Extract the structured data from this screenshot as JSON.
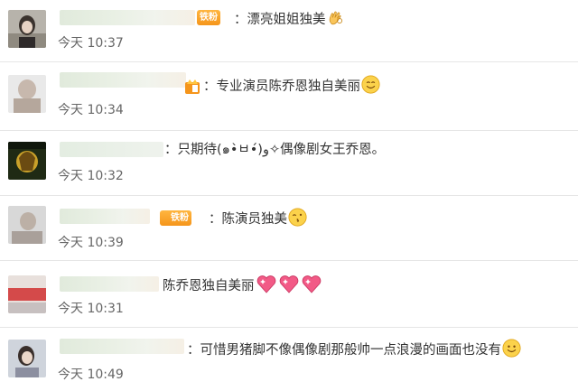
{
  "comments": [
    {
      "prefix": "：",
      "text": "漂亮姐姐独美",
      "emoji": "ok-hand-emoji",
      "badge": "铁粉",
      "time": "今天 10:37"
    },
    {
      "prefix": "：",
      "text": "专业演员陈乔恩独自美丽",
      "emoji": "smile-emoji",
      "badge": "",
      "time": "今天 10:34"
    },
    {
      "prefix": "：",
      "text": "只期待(๑•̀ㅂ•́)و✧偶像剧女王乔恩。",
      "emoji": "",
      "badge": "",
      "time": "今天 10:32"
    },
    {
      "prefix": "：",
      "text": "陈演员独美",
      "emoji": "kiss-emoji",
      "badge": "铁粉",
      "time": "今天 10:39"
    },
    {
      "prefix": "",
      "text": "陈乔恩独自美丽",
      "emoji": "hearts-emoji",
      "badge": "",
      "time": "今天 10:31"
    },
    {
      "prefix": "：",
      "text": "可惜男猪脚不像偶像剧那般帅一点浪漫的画面也没有",
      "emoji": "smile-emoji",
      "badge": "",
      "time": "今天 10:49"
    }
  ]
}
